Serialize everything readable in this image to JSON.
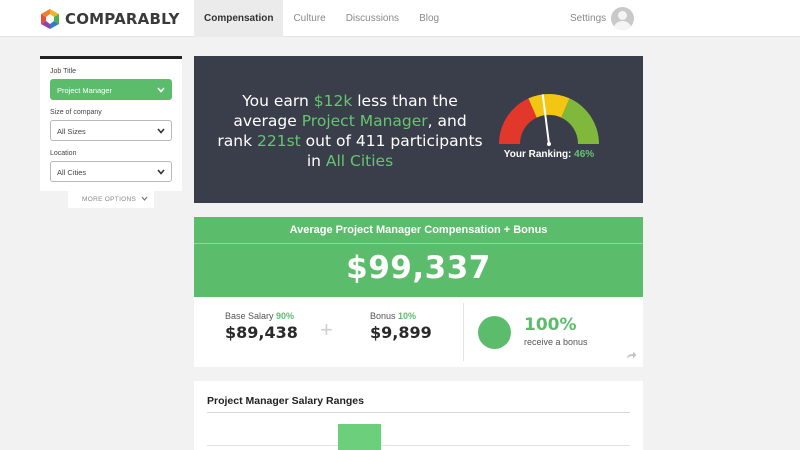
{
  "brand": {
    "name": "COMPARABLY"
  },
  "nav": {
    "tabs": [
      {
        "label": "Compensation",
        "active": true
      },
      {
        "label": "Culture",
        "active": false
      },
      {
        "label": "Discussions",
        "active": false
      },
      {
        "label": "Blog",
        "active": false
      }
    ],
    "settings_label": "Settings",
    "avatar_icon": "user-avatar-icon"
  },
  "filters": {
    "job_title": {
      "label": "Job Title",
      "value": "Project Manager"
    },
    "company_size": {
      "label": "Size of company",
      "value": "All Sizes"
    },
    "location": {
      "label": "Location",
      "value": "All Cities"
    },
    "more_options_label": "MORE OPTIONS"
  },
  "hero": {
    "t1": "You earn ",
    "amount": "$12k",
    "t2": " less than the average ",
    "job": "Project Manager",
    "t3": ", and rank ",
    "rank": "221st",
    "t4": " out of 411 participants in ",
    "location": "All Cities",
    "ranking_label": "Your Ranking: ",
    "ranking_value": "46%",
    "ranking_fraction": 0.46
  },
  "average": {
    "title": "Average Project Manager Compensation + Bonus",
    "value": "$99,337"
  },
  "breakdown": {
    "base_label": "Base Salary",
    "base_pct": "90%",
    "base_value": "$89,438",
    "bonus_label": "Bonus",
    "bonus_pct": "10%",
    "bonus_value": "$9,899",
    "receive_pct": "100%",
    "receive_label": "receive a bonus"
  },
  "ranges": {
    "title": "Project Manager Salary Ranges"
  },
  "colors": {
    "accent_green": "#5bbd6b",
    "hero_bg": "#3a3e4a",
    "gauge_red": "#e2382c",
    "gauge_yellow": "#f3c614",
    "gauge_green": "#7fb83a"
  }
}
